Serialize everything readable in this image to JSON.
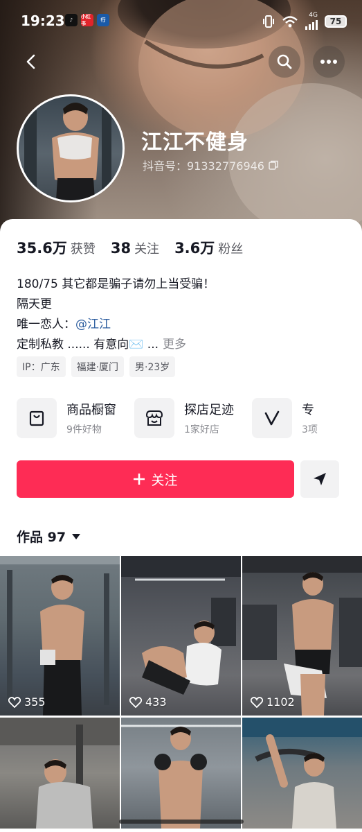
{
  "status_bar": {
    "time": "19:23",
    "network": "4G",
    "battery": "75"
  },
  "profile": {
    "nickname": "江江不健身",
    "douyin_id": "抖音号：91332776946"
  },
  "stats": [
    {
      "value": "35.6万",
      "label": "获赞"
    },
    {
      "value": "38",
      "label": "关注"
    },
    {
      "value": "3.6万",
      "label": "粉丝"
    }
  ],
  "bio": {
    "line1": "180/75  其它都是骗子请勿上当受骗！",
    "line2": "隔天更",
    "line3_prefix": "唯一恋人：",
    "line3_mention": "@江江",
    "line4": "定制私教  ...... 有意向✉️ ...",
    "more": "更多"
  },
  "tags": [
    "IP：广东",
    "福建·厦门",
    "男·23岁"
  ],
  "shortcuts": [
    {
      "title": "商品橱窗",
      "subtitle": "9件好物",
      "icon": "shopping-bag-icon"
    },
    {
      "title": "探店足迹",
      "subtitle": "1家好店",
      "icon": "store-icon"
    },
    {
      "title": "专",
      "subtitle": "3项",
      "icon": "v-icon"
    }
  ],
  "actions": {
    "follow": "关注"
  },
  "works_tab": {
    "label": "作品 97"
  },
  "videos": [
    {
      "likes": "355"
    },
    {
      "likes": "433"
    },
    {
      "likes": "1102"
    },
    {
      "likes": ""
    },
    {
      "likes": ""
    },
    {
      "likes": ""
    }
  ],
  "colors": {
    "accent": "#fe2c55",
    "mention": "#2b5c9e",
    "secondary_text": "#8a8b91"
  }
}
